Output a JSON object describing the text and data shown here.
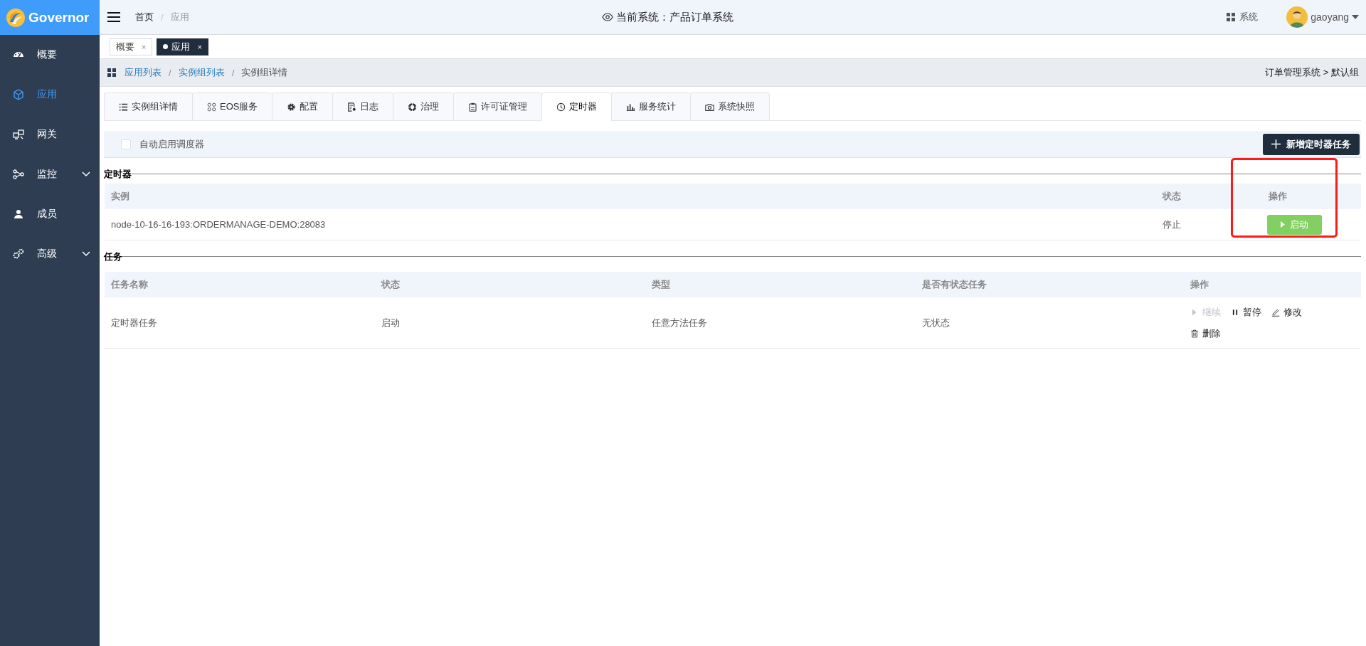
{
  "app": {
    "name": "Governor"
  },
  "sidebar": {
    "items": [
      {
        "label": "概要",
        "kind": "dashboard",
        "selected": false
      },
      {
        "label": "应用",
        "kind": "cube",
        "selected": true
      },
      {
        "label": "网关",
        "kind": "gateway",
        "selected": false
      },
      {
        "label": "监控",
        "kind": "monitor",
        "selected": false,
        "expanded": false
      },
      {
        "label": "成员",
        "kind": "user",
        "selected": false
      },
      {
        "label": "高级",
        "kind": "gears",
        "selected": false,
        "expanded": false
      }
    ]
  },
  "header": {
    "breadcrumb": {
      "items": [
        "首页",
        "应用"
      ],
      "separator": "/"
    },
    "current_system": "当前系统：产品订单系统",
    "system_menu": "系统",
    "user": "gaoyang"
  },
  "open_tabs": [
    {
      "label": "概要",
      "selected": false,
      "close": "×"
    },
    {
      "label": "应用",
      "selected": true,
      "close": "×"
    }
  ],
  "page_breadcrumb": {
    "items": [
      {
        "label": "应用列表",
        "link": true
      },
      {
        "label": "实例组列表",
        "link": true
      },
      {
        "label": "实例组详情",
        "link": false
      }
    ],
    "separator": "/",
    "context": "订单管理系统 > 默认组"
  },
  "tabs": [
    {
      "label": "实例组详情",
      "kind": "list",
      "selected": false
    },
    {
      "label": "EOS服务",
      "kind": "grid",
      "selected": false
    },
    {
      "label": "配置",
      "kind": "gear",
      "selected": false
    },
    {
      "label": "日志",
      "kind": "log",
      "selected": false
    },
    {
      "label": "治理",
      "kind": "lifebuoy",
      "selected": false
    },
    {
      "label": "许可证管理",
      "kind": "clipboard",
      "selected": false
    },
    {
      "label": "定时器",
      "kind": "clock",
      "selected": true
    },
    {
      "label": "服务统计",
      "kind": "bars",
      "selected": false
    },
    {
      "label": "系统快照",
      "kind": "camera",
      "selected": false
    }
  ],
  "auto_scheduler": {
    "label": "自动启用调度器",
    "checked": false
  },
  "add_button": "新增定时器任务",
  "timer_section": {
    "title": "定时器",
    "columns": [
      "实例",
      "状态",
      "操作"
    ],
    "rows": [
      {
        "instance": "node-10-16-16-193:ORDERMANAGE-DEMO:28083",
        "status": "停止",
        "action": "启动"
      }
    ]
  },
  "task_section": {
    "title": "任务",
    "columns": [
      "任务名称",
      "状态",
      "类型",
      "是否有状态任务",
      "操作"
    ],
    "rows": [
      {
        "name": "定时器任务",
        "status": "启动",
        "type": "任意方法任务",
        "stateful": "无状态",
        "actions": [
          {
            "label": "继续",
            "kind": "resume",
            "disabled": true
          },
          {
            "label": "暂停",
            "kind": "pause",
            "disabled": false
          },
          {
            "label": "修改",
            "kind": "edit",
            "disabled": false
          },
          {
            "label": "删除",
            "kind": "delete",
            "disabled": false
          }
        ]
      }
    ]
  },
  "annotation": {
    "kind": "rectangle"
  }
}
